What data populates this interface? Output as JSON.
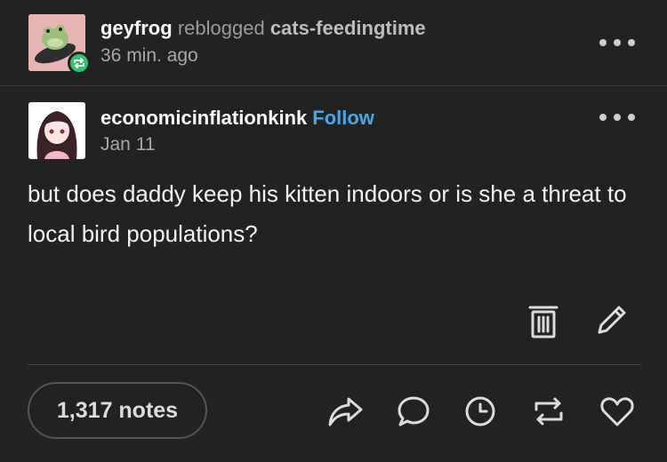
{
  "reblog": {
    "username": "geyfrog",
    "action": "reblogged",
    "source": "cats-feedingtime",
    "time": "36 min. ago"
  },
  "post": {
    "author": "economicinflationkink",
    "follow_label": "Follow",
    "date": "Jan 11",
    "body": "but does daddy keep his kitten indoors or is she a threat to local bird populations?"
  },
  "footer": {
    "notes": "1,317 notes"
  },
  "icons": [
    "more-icon",
    "reblog-badge-icon",
    "trash-icon",
    "pencil-icon",
    "share-icon",
    "comment-icon",
    "clock-icon",
    "reblog-icon",
    "heart-icon"
  ],
  "colors": {
    "background": "#222222",
    "follow": "#4aa8e8",
    "reblog_badge": "#33c16d"
  }
}
